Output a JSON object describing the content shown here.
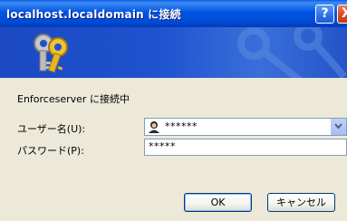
{
  "window": {
    "title": "localhost.localdomain に接続",
    "help_symbol": "?",
    "close_symbol": "X",
    "icon": "keys-icon"
  },
  "dialog": {
    "connecting_text": "Enforceserver に接続中",
    "username_label": "ユーザー名(U):",
    "password_label": "パスワード(P):",
    "username_value": "******",
    "password_value": "*****",
    "ok_label": "OK",
    "cancel_label": "キャンセル"
  }
}
